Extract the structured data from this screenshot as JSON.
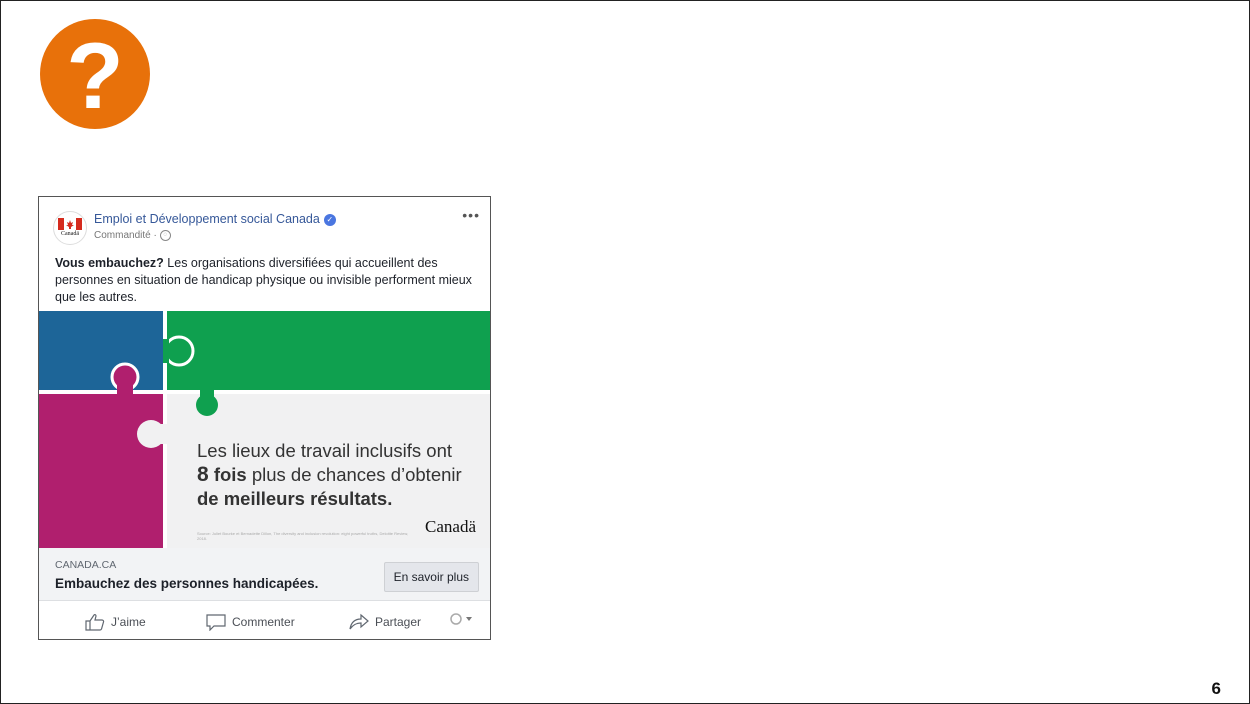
{
  "slide": {
    "question_mark": "?",
    "page_number": "6"
  },
  "post": {
    "page_name": "Emploi et Développement social Canada",
    "verified_glyph": "✓",
    "sponsored_label": "Commandité ·",
    "more_label": "•••",
    "avatar_word": "Canadä",
    "text_bold": "Vous embauchez?",
    "text_rest": " Les organisations diversifiées qui accueillent des personnes en situation de handicap physique ou invisible performent mieux que les autres.",
    "image": {
      "line1": "Les lieux de travail inclusifs ont",
      "number": "8",
      "line2_rest": "fois",
      "line2_tail": " plus de chances d’obtenir",
      "line3": "de meilleurs résultats.",
      "source_note": "Source: Juliet Bourke et Bernadette Dillon, The diversity and inclusion revolution: eight powerful truths, Deloitte Review, 2018.",
      "wordmark": "Canadä",
      "colors": {
        "blue": "#1d6598",
        "green": "#0fa04f",
        "magenta": "#b01f6e",
        "light": "#f1f1f2"
      }
    },
    "link": {
      "domain": "CANADA.CA",
      "title": "Embauchez des personnes handicapées.",
      "cta_label": "En savoir plus"
    },
    "actions": {
      "like": "J’aime",
      "comment": "Commenter",
      "share": "Partager"
    }
  }
}
